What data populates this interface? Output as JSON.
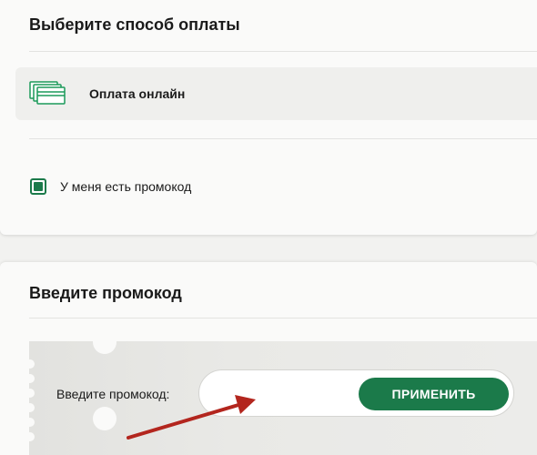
{
  "payment": {
    "title": "Выберите способ оплаты",
    "option_label": "Оплата онлайн",
    "option_icon": "credit-cards-icon",
    "promo_checkbox_label": "У меня есть промокод",
    "promo_checkbox_checked": true
  },
  "promo": {
    "title": "Введите промокод",
    "field_label": "Введите промокод:",
    "input_value": "",
    "apply_label": "ПРИМЕНИТЬ"
  },
  "colors": {
    "accent": "#1b7a4a",
    "annotation_arrow": "#b3261e"
  }
}
